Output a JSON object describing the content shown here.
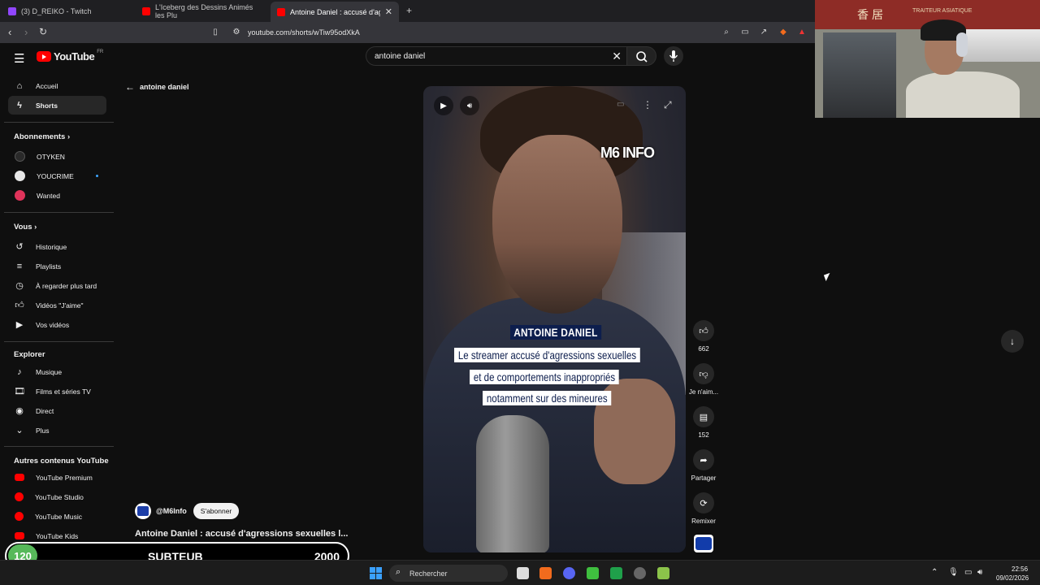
{
  "browser": {
    "tabs": [
      {
        "title": "(3) D_REIKO - Twitch",
        "favicon_color": "#9146ff",
        "active": false
      },
      {
        "title": "L'Iceberg des Dessins Animés les Plu",
        "favicon_color": "#ff0000",
        "active": false
      },
      {
        "title": "Antoine Daniel : accusé d'agressi",
        "favicon_color": "#ff0000",
        "active": true
      }
    ],
    "new_tab_symbol": "+",
    "url": "youtube.com/shorts/wTiw95odXkA"
  },
  "youtube": {
    "logo_text": "YouTube",
    "country_code": "FR",
    "search": {
      "value": "antoine daniel"
    },
    "back_label": "antoine daniel"
  },
  "sidebar": {
    "main": [
      {
        "label": "Accueil",
        "icon": "home-icon",
        "active": false
      },
      {
        "label": "Shorts",
        "icon": "shorts-icon",
        "active": true
      }
    ],
    "subscriptions_header": "Abonnements",
    "subscriptions": [
      {
        "label": "OTYKEN",
        "color": "#1e1e1e",
        "new": false
      },
      {
        "label": "YOUCRIME",
        "color": "#e8e8e8",
        "new": true
      },
      {
        "label": "Wanted",
        "color": "#e0335a",
        "new": false
      }
    ],
    "you_header": "Vous",
    "you": [
      {
        "label": "Historique",
        "icon": "history-icon"
      },
      {
        "label": "Playlists",
        "icon": "playlists-icon"
      },
      {
        "label": "À regarder plus tard",
        "icon": "watch-later-icon"
      },
      {
        "label": "Vidéos \"J'aime\"",
        "icon": "liked-videos-icon"
      },
      {
        "label": "Vos vidéos",
        "icon": "your-videos-icon"
      }
    ],
    "explore_header": "Explorer",
    "explore": [
      {
        "label": "Musique",
        "icon": "music-icon"
      },
      {
        "label": "Films et séries TV",
        "icon": "movies-icon"
      },
      {
        "label": "Direct",
        "icon": "live-icon"
      },
      {
        "label": "Plus",
        "icon": "chevron-down-icon"
      }
    ],
    "other_header": "Autres contenus YouTube",
    "other": [
      {
        "label": "YouTube Premium",
        "color": "#ff0000"
      },
      {
        "label": "YouTube Studio",
        "color": "#ff0000"
      },
      {
        "label": "YouTube Music",
        "color": "#ff0000"
      },
      {
        "label": "YouTube Kids",
        "color": "#ff0000"
      }
    ]
  },
  "video": {
    "logo_text": "M6 INFO",
    "caption_title": "ANTOINE DANIEL",
    "caption_lines": [
      "Le streamer accusé d'agressions sexuelles",
      "et de comportements inappropriés",
      "notamment sur des mineures"
    ]
  },
  "actions": {
    "like_count": "662",
    "dislike_label": "Je n'aim...",
    "comment_count": "152",
    "share_label": "Partager",
    "remix_label": "Remixer"
  },
  "channel": {
    "handle": "@M6Info",
    "subscribe_label": "S'abonner",
    "video_title": "Antoine Daniel : accusé d'agressions sexuelles l..."
  },
  "overlay": {
    "count": "120",
    "label": "SUBTEUB",
    "goal": "2000"
  },
  "taskbar": {
    "search_placeholder": "Rechercher",
    "time": "22:56",
    "date": "09/02/2026"
  },
  "webcam": {
    "sign_cjk": "香居",
    "sign_text": "TRAITEUR ASIATIQUE"
  }
}
